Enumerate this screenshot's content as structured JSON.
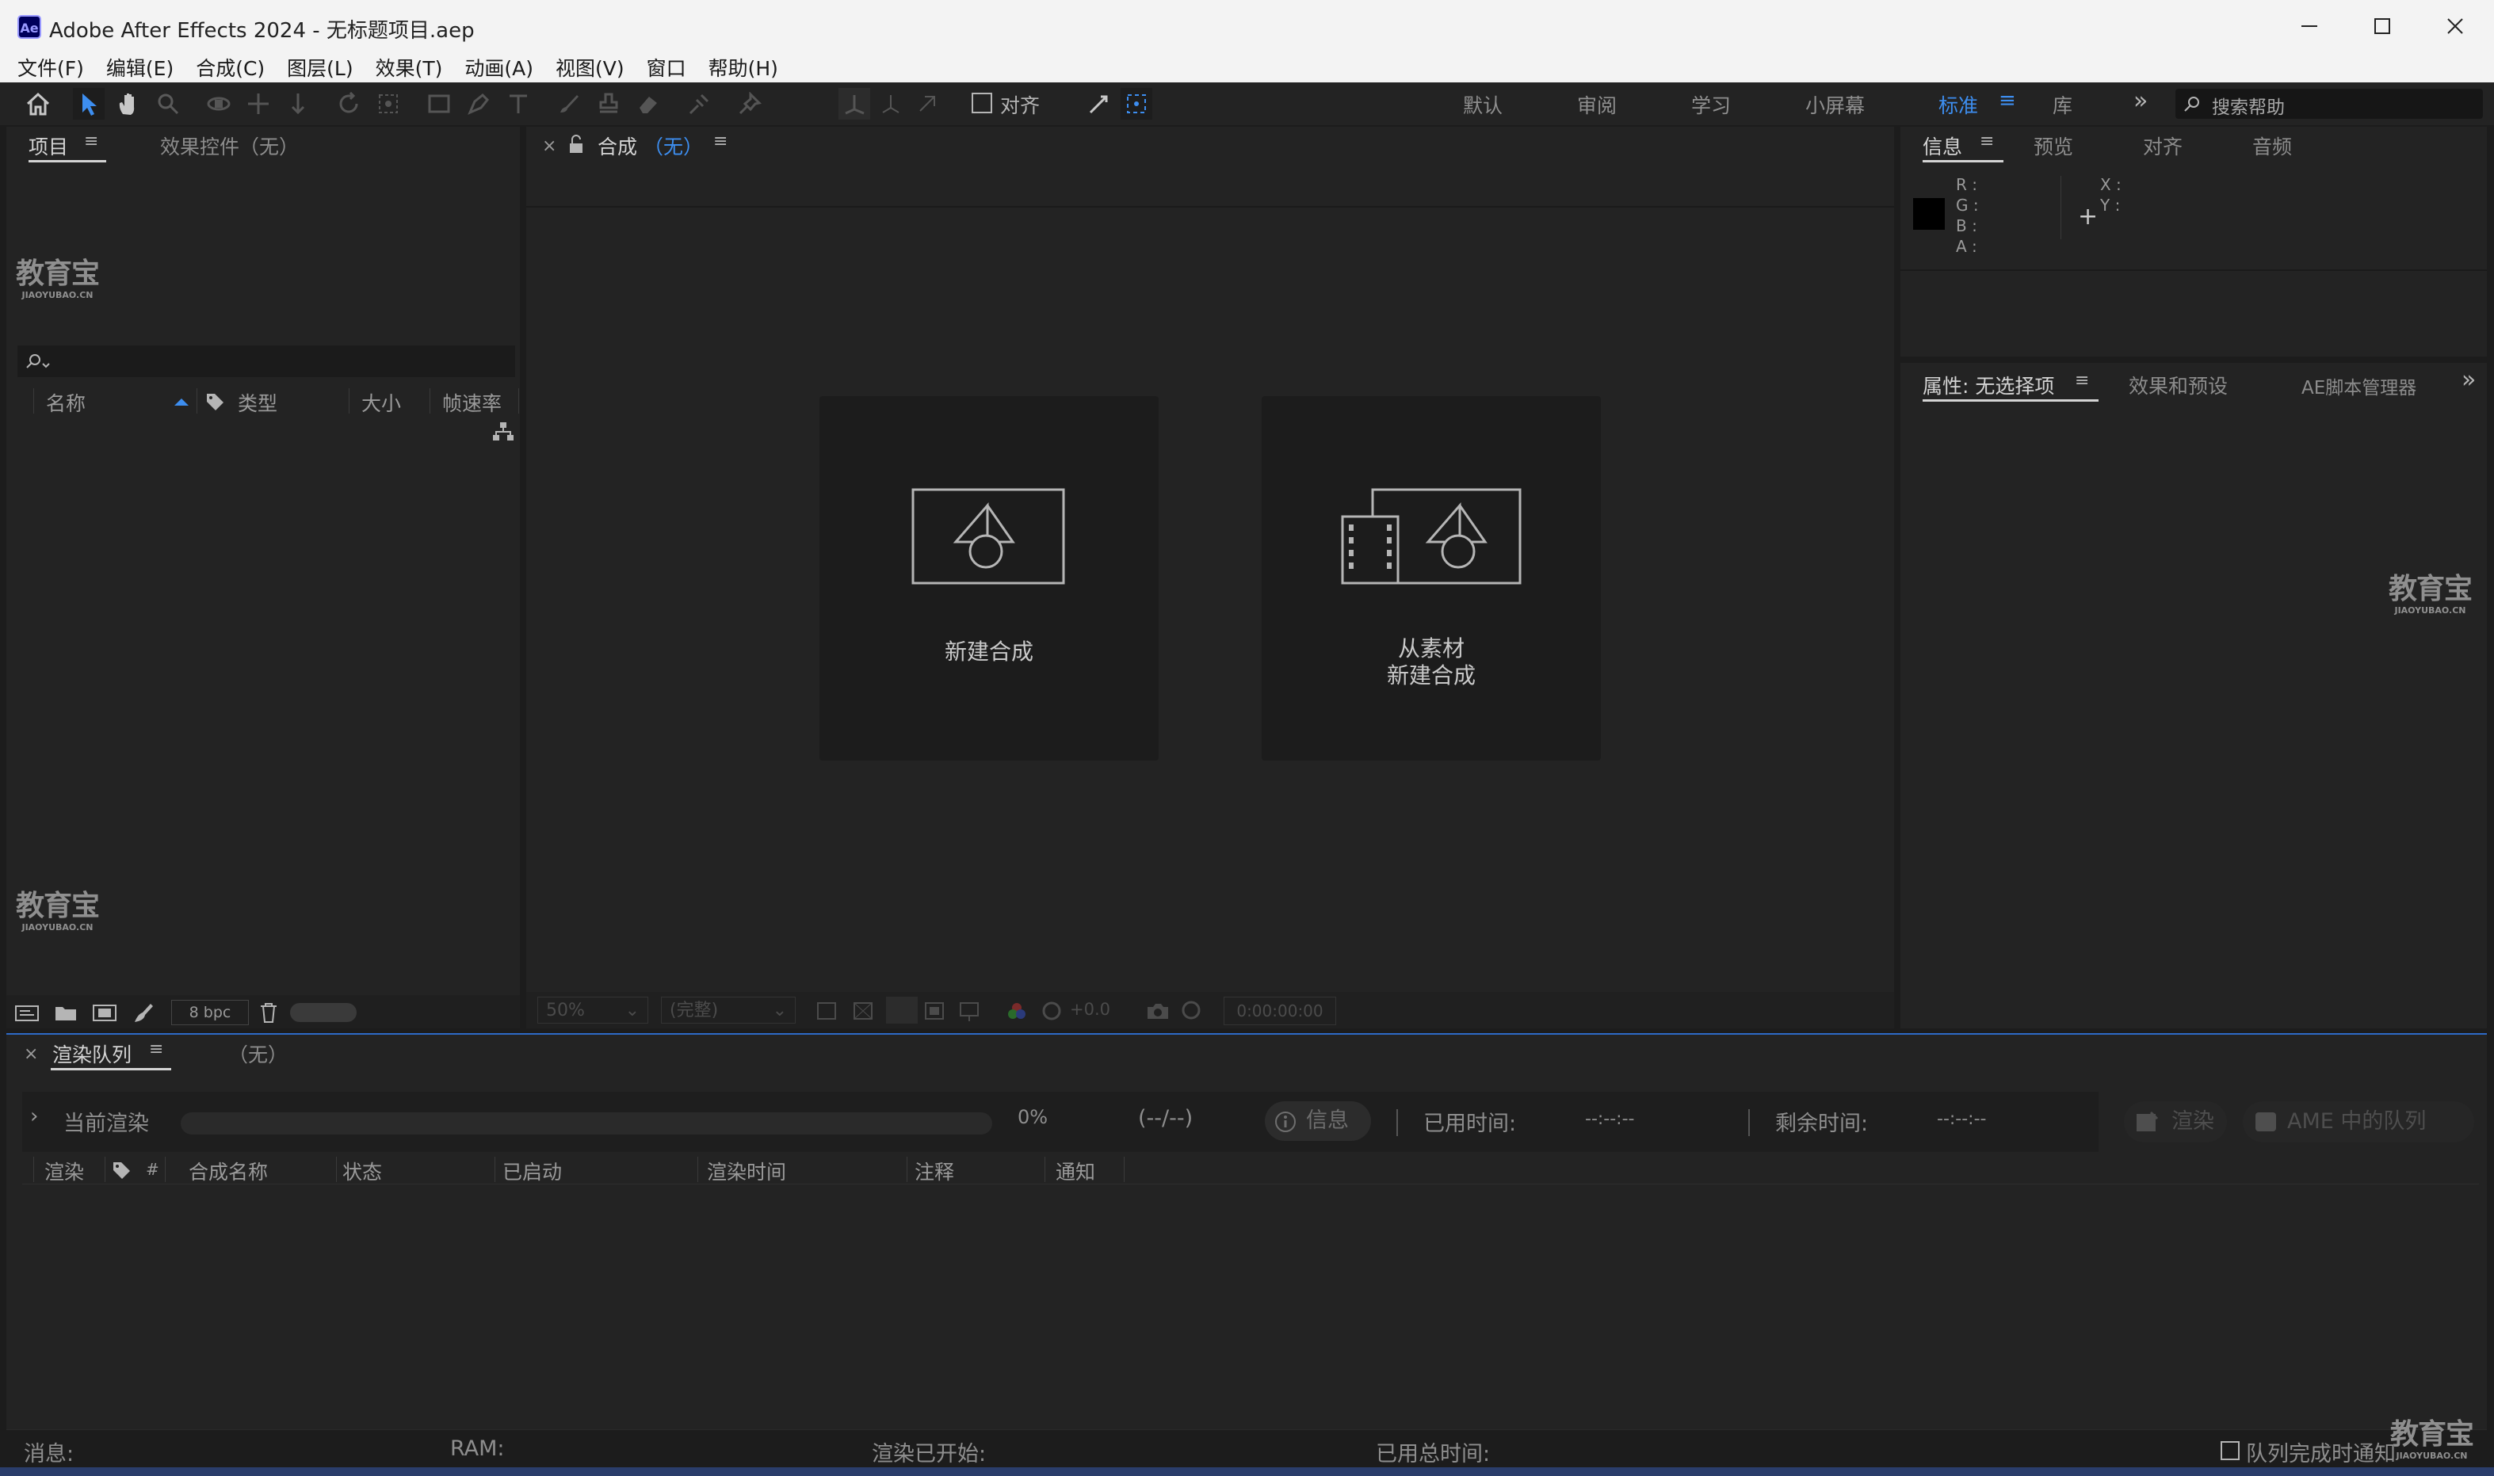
{
  "window": {
    "app_icon_text": "Ae",
    "title": "Adobe After Effects 2024 - 无标题项目.aep"
  },
  "menu": [
    "文件(F)",
    "编辑(E)",
    "合成(C)",
    "图层(L)",
    "效果(T)",
    "动画(A)",
    "视图(V)",
    "窗口",
    "帮助(H)"
  ],
  "toolbar": {
    "align_label": "对齐",
    "workspaces": [
      "默认",
      "审阅",
      "学习",
      "小屏幕",
      "标准",
      "库"
    ],
    "active_workspace": "标准",
    "search_placeholder": "搜索帮助"
  },
  "project_panel": {
    "tab_project": "项目",
    "tab_effects": "效果控件（无）",
    "columns": [
      "名称",
      "类型",
      "大小",
      "帧速率"
    ],
    "bpc": "8 bpc"
  },
  "comp_panel": {
    "tab_prefix": "合成",
    "tab_suffix": "（无）",
    "new_comp_label": "新建合成",
    "from_footage_line1": "从素材",
    "from_footage_line2": "新建合成",
    "zoom": "50%",
    "resolution": "(完整)",
    "exposure": "+0.0",
    "timecode": "0:00:00:00"
  },
  "info_panel": {
    "tabs": [
      "信息",
      "预览",
      "对齐",
      "音频"
    ],
    "rgba_labels": [
      "R :",
      "G :",
      "B :",
      "A :"
    ],
    "xy_labels": [
      "X :",
      "Y :"
    ],
    "swatch_color": "#000000"
  },
  "properties_panel": {
    "tab_properties": "属性: 无选择项",
    "tab_effects_presets": "效果和预设",
    "tab_scripts": "AE脚本管理器"
  },
  "render_queue": {
    "tab": "渲染队列",
    "tab_none": "（无）",
    "current_render": "当前渲染",
    "progress": 0,
    "percent": "0%",
    "frames": "(--/--)",
    "info_btn": "信息",
    "elapsed_label": "已用时间:",
    "elapsed_value": "--:--:--",
    "remaining_label": "剩余时间:",
    "remaining_value": "--:--:--",
    "render_btn": "渲染",
    "ame_btn": "AME 中的队列",
    "columns": [
      "渲染",
      "#",
      "合成名称",
      "状态",
      "已启动",
      "渲染时间",
      "注释",
      "通知"
    ]
  },
  "status_bar": {
    "message": "消息:",
    "ram": "RAM:",
    "render_started": "渲染已开始:",
    "total_time": "已用总时间:",
    "notify_label": "队列完成时通知"
  },
  "watermark": {
    "big": "教育宝",
    "small": "JIAOYUBAO.CN"
  }
}
